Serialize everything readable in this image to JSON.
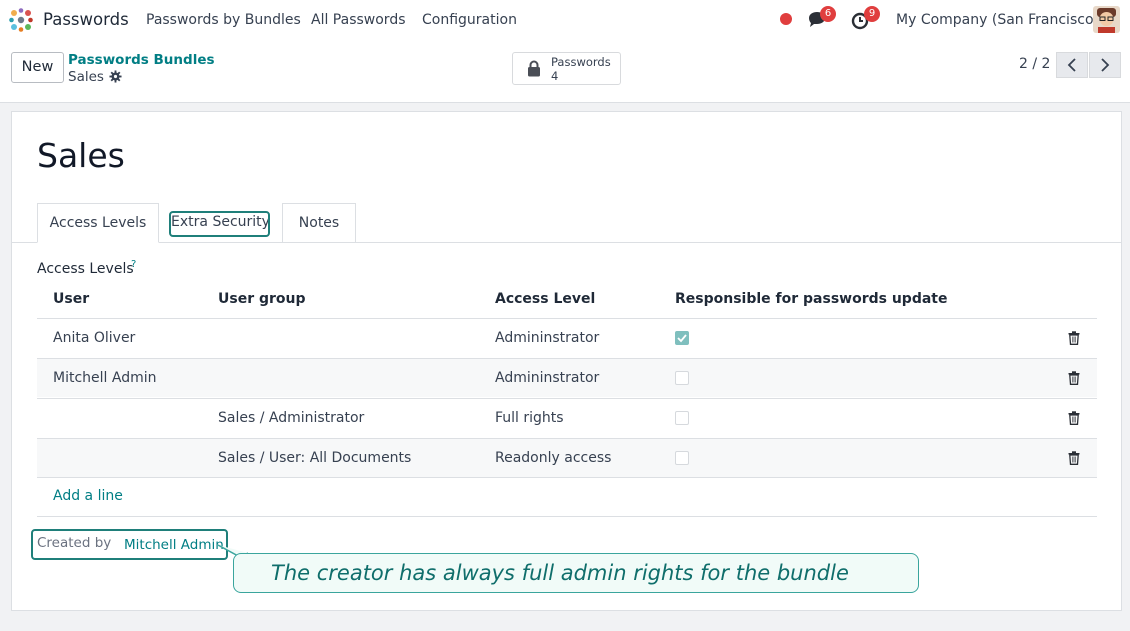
{
  "navbar": {
    "app_name": "Passwords",
    "menus": [
      "Passwords by Bundles",
      "All Passwords",
      "Configuration"
    ],
    "messages_count": "6",
    "activities_count": "9",
    "company": "My Company (San Francisco)"
  },
  "control_panel": {
    "new_label": "New",
    "breadcrumb_parent": "Passwords Bundles",
    "breadcrumb_current": "Sales",
    "smart_button": {
      "label": "Passwords",
      "count": "4"
    },
    "pager": "2 / 2"
  },
  "form": {
    "title": "Sales",
    "tabs": [
      "Access Levels",
      "Extra Security",
      "Notes"
    ],
    "active_tab": "Access Levels",
    "section_label": "Access Levels",
    "help_mark": "?",
    "columns": [
      "User",
      "User group",
      "Access Level",
      "Responsible for passwords update"
    ],
    "rows": [
      {
        "user": "Anita Oliver",
        "group": "",
        "level": "Admininstrator",
        "responsible": true
      },
      {
        "user": "Mitchell Admin",
        "group": "",
        "level": "Admininstrator",
        "responsible": false
      },
      {
        "user": "",
        "group": "Sales / Administrator",
        "level": "Full rights",
        "responsible": false
      },
      {
        "user": "",
        "group": "Sales / User: All Documents",
        "level": "Readonly access",
        "responsible": false
      }
    ],
    "add_line": "Add a line",
    "created_by_label": "Created by",
    "created_by_value": "Mitchell Admin",
    "callout": "The creator has always full admin rights for the bundle"
  },
  "colors": {
    "accent": "#017e84",
    "highlight_border": "#1f7f7a",
    "badge": "#e03e3e"
  },
  "icons": [
    "apps-icon",
    "chat-icon",
    "clock-icon",
    "gear-icon",
    "lock-icon",
    "chevron-left-icon",
    "chevron-right-icon",
    "trash-icon"
  ]
}
